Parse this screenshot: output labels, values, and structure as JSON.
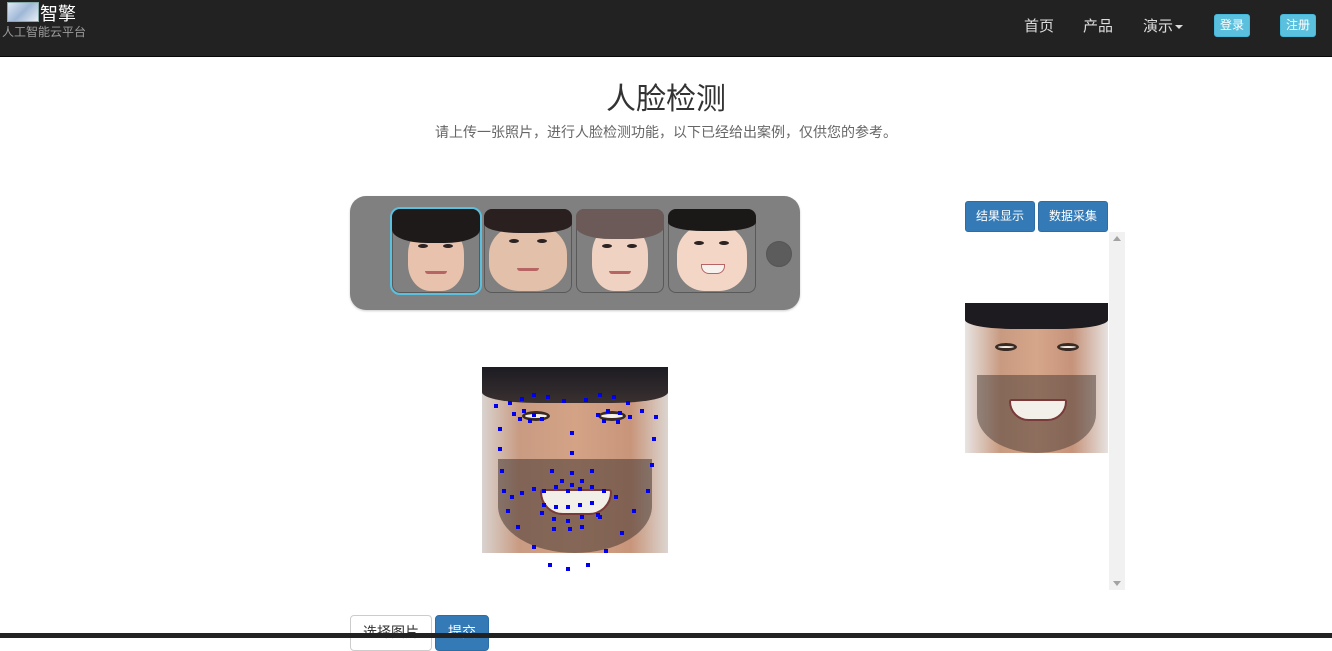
{
  "navbar": {
    "brand_name": "智擎",
    "brand_subtitle": "人工智能云平台",
    "links": [
      "首页",
      "产品",
      "演示"
    ],
    "login_label": "登录",
    "register_label": "注册"
  },
  "header": {
    "title": "人脸检测",
    "subtitle": "请上传一张照片，进行人脸检测功能，以下已经给出案例，仅供您的参考。"
  },
  "carousel": {
    "thumbnails": [
      "sample-face-1",
      "sample-face-2",
      "sample-face-3",
      "sample-face-4"
    ],
    "active_index": 0
  },
  "result_panel": {
    "result_button_label": "结果显示",
    "collect_button_label": "数据采集"
  },
  "actions": {
    "choose_label": "选择图片",
    "submit_label": "提交"
  },
  "colors": {
    "navbar_bg": "#222222",
    "primary": "#337ab7",
    "info": "#5bc0de",
    "landmark": "#0000ee"
  },
  "icons": [
    "caret-down-icon",
    "scroll-up-icon",
    "scroll-down-icon",
    "carousel-next-icon"
  ]
}
